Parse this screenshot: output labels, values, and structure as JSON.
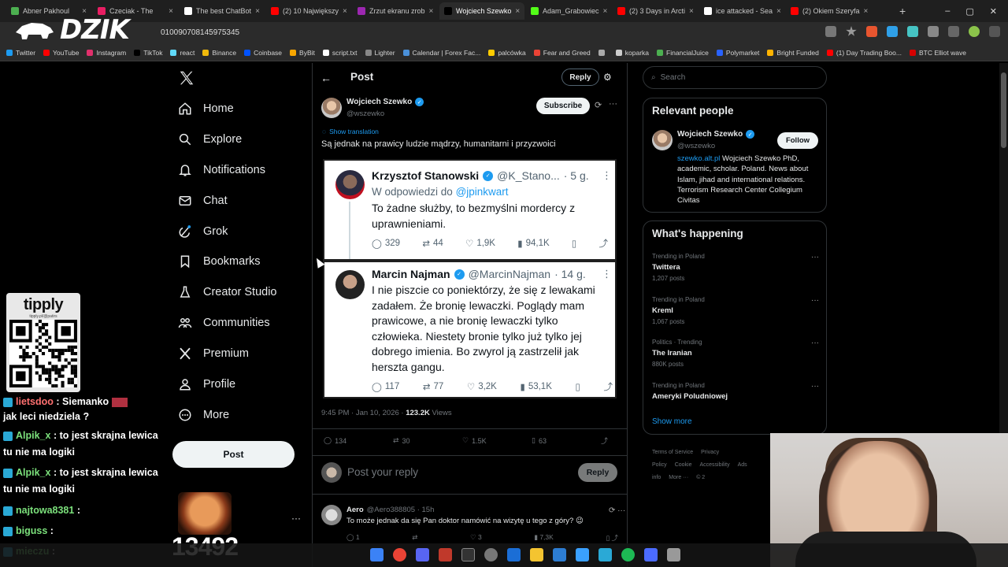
{
  "browser": {
    "tabs": [
      {
        "title": "Abner Pakhoul",
        "color": "#4caf50"
      },
      {
        "title": "Czeciak - The",
        "color": "#e91e63"
      },
      {
        "title": "The best ChatBot",
        "color": "#ffffff"
      },
      {
        "title": "(2) 10 Największy",
        "color": "#ff0000"
      },
      {
        "title": "Zrzut ekranu zrob",
        "color": "#9c27b0"
      },
      {
        "title": "Wojciech Szewko",
        "color": "#000000",
        "active": true
      },
      {
        "title": "Adam_Grabowiec",
        "color": "#53fc18"
      },
      {
        "title": "(2) 3 Days in Arcti",
        "color": "#ff0000"
      },
      {
        "title": "ice attacked - Sea",
        "color": "#ffffff"
      },
      {
        "title": "(2) Okiem Szeryfa",
        "color": "#ff0000"
      }
    ],
    "new_tab": "+",
    "url": "010090708145975345",
    "bookmarks": [
      {
        "label": "Twitter",
        "color": "#1d9bf0"
      },
      {
        "label": "YouTube",
        "color": "#ff0000"
      },
      {
        "label": "Instagram",
        "color": "#e1306c"
      },
      {
        "label": "TikTok",
        "color": "#000000"
      },
      {
        "label": "react",
        "color": "#61dafb"
      },
      {
        "label": "Binance",
        "color": "#f0b90b"
      },
      {
        "label": "Coinbase",
        "color": "#0052ff"
      },
      {
        "label": "ByBit",
        "color": "#f7a600"
      },
      {
        "label": "script.txt",
        "color": "#ffffff"
      },
      {
        "label": "Lighter",
        "color": "#888888"
      },
      {
        "label": "Calendar | Forex Fac...",
        "color": "#4a90d9"
      },
      {
        "label": "palcówka",
        "color": "#ffcc00"
      },
      {
        "label": "Fear and Greed",
        "color": "#ea4335"
      },
      {
        "label": "",
        "color": "#aaaaaa"
      },
      {
        "label": "koparka",
        "color": "#cccccc"
      },
      {
        "label": "FinancialJuice",
        "color": "#4caf50"
      },
      {
        "label": "Polymarket",
        "color": "#2962ff"
      },
      {
        "label": "Bright Funded",
        "color": "#ffb300"
      },
      {
        "label": "(1) Day Trading Boo...",
        "color": "#ff0000"
      },
      {
        "label": "BTC Elliot wave",
        "color": "#d50000"
      }
    ]
  },
  "stream": {
    "logo_text": "DZIK",
    "tipply_title": "tipply",
    "tipply_url": "tipply.pl/@patirs",
    "chat": [
      {
        "user": "lietsdoo",
        "text": ": Siemanko",
        "emote": true
      },
      {
        "user": "",
        "text": "jak leci niedziela ?"
      },
      {
        "user": "Alpik_x",
        "text": ": to jest skrajna lewica tu nie ma logiki"
      },
      {
        "user": "Alpik_x",
        "text": ": to jest skrajna lewica tu nie ma logiki"
      },
      {
        "user": "najtowa8381",
        "text": ":"
      },
      {
        "user": "biguss",
        "text": ":"
      },
      {
        "user": "mieczu",
        "text": ":"
      }
    ],
    "counter": "13492"
  },
  "nav": {
    "items": [
      {
        "label": "Home",
        "icon": "home-icon"
      },
      {
        "label": "Explore",
        "icon": "search-icon"
      },
      {
        "label": "Notifications",
        "icon": "bell-icon"
      },
      {
        "label": "Chat",
        "icon": "mail-icon"
      },
      {
        "label": "Grok",
        "icon": "grok-icon"
      },
      {
        "label": "Bookmarks",
        "icon": "bookmark-icon"
      },
      {
        "label": "Creator Studio",
        "icon": "flask-icon"
      },
      {
        "label": "Communities",
        "icon": "people-icon"
      },
      {
        "label": "Premium",
        "icon": "x-icon"
      },
      {
        "label": "Profile",
        "icon": "person-icon"
      },
      {
        "label": "More",
        "icon": "more-circle-icon"
      }
    ],
    "post_button": "Post",
    "more_dots": "···"
  },
  "main": {
    "header": "Post",
    "reply_top": "Reply",
    "author": {
      "name": "Wojciech Szewko",
      "handle": "@wszewko"
    },
    "subscribe": "Subscribe",
    "show_translation": "Show translation",
    "text": "Są jednak na prawicy ludzie mądrzy, humanitarni i przyzwoici",
    "embed": {
      "tweet1": {
        "name": "Krzysztof Stanowski",
        "handle": "@K_Stano...",
        "time": "· 5 g.",
        "reply_to_prefix": "W odpowiedzi do",
        "reply_to": "@jpinkwart",
        "text": "To żadne służby, to bezmyślni mordercy z uprawnieniami.",
        "replies": "329",
        "reposts": "44",
        "likes": "1,9K",
        "views": "94,1K"
      },
      "tweet2": {
        "name": "Marcin Najman",
        "handle": "@MarcinNajman",
        "time": "· 14 g.",
        "text": "I nie piszcie co poniektórzy, że się z lewakami zadałem. Że bronię lewaczki. Poglądy mam prawicowe, a nie bronię lewaczki tylko człowieka. Niestety bronie tylko już tylko jej dobrego imienia. Bo zwyrol ją zastrzelił jak herszta gangu.",
        "replies": "117",
        "reposts": "77",
        "likes": "3,2K",
        "views": "53,1K"
      }
    },
    "timestamp": "9:45 PM · Jan 10, 2026 ·",
    "views_count": "123.2K",
    "views_label": "Views",
    "stats": {
      "replies": "134",
      "reposts": "30",
      "likes": "1.5K",
      "bookmarks": "63"
    },
    "reply_placeholder": "Post your reply",
    "reply_button": "Reply",
    "comment": {
      "name": "Aero",
      "handle": "@Aero388805 · 15h",
      "text": "To może jednak da się Pan doktor namówić na wizytę u tego z góry? 😉",
      "replies": "1",
      "reposts": "",
      "likes": "3",
      "views": "7,3K"
    }
  },
  "right": {
    "search_placeholder": "Search",
    "relevant_title": "Relevant people",
    "person": {
      "name": "Wojciech Szewko",
      "handle": "@wszewko",
      "follow": "Follow",
      "bio_link": "szewko.alt.pl",
      "bio": " Wojciech Szewko PhD, academic, scholar. Poland. News about Islam, jihad and international relations. Terrorism Research Center Collegium Civitas"
    },
    "happening_title": "What's happening",
    "trends": [
      {
        "meta": "Trending in Poland",
        "name": "Twittera",
        "posts": "1,207 posts"
      },
      {
        "meta": "Trending in Poland",
        "name": "Kreml",
        "posts": "1,067 posts"
      },
      {
        "meta": "Politics · Trending",
        "name": "The Iranian",
        "posts": "880K posts"
      },
      {
        "meta": "Trending in Poland",
        "name": "Ameryki Poludniowej",
        "posts": ""
      }
    ],
    "show_more": "Show more",
    "footer": [
      "Terms of Service",
      "Privacy Policy",
      "Cookie",
      "Accessibility",
      "Ads info",
      "More ···",
      "© 2"
    ]
  },
  "colors": {
    "accent": "#1d9bf0",
    "bg": "#000000",
    "border": "#2f3336",
    "muted": "#71767b"
  }
}
